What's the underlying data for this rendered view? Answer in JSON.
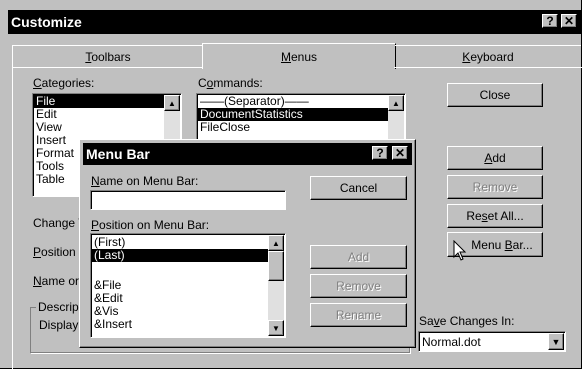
{
  "customize": {
    "title": "Customize",
    "help_btn": "?",
    "close_btn": "✕",
    "tabs": [
      {
        "label": "Toolbars",
        "key": "T",
        "rest": "oolbars"
      },
      {
        "label": "Menus",
        "key": "M",
        "rest": "enus"
      },
      {
        "label": "Keyboard",
        "key": "K",
        "rest": "eyboard"
      }
    ],
    "categories_label_key": "C",
    "categories_label_rest": "ategories:",
    "categories": [
      "File",
      "Edit",
      "View",
      "Insert",
      "Format",
      "Tools",
      "Table"
    ],
    "commands_label_pre": "C",
    "commands_label_key": "o",
    "commands_label_rest": "mmands:",
    "commands": [
      "——(Separator)——",
      "DocumentStatistics",
      "FileClose"
    ],
    "change_label": "Change V",
    "position_label_key": "P",
    "position_label_rest": "osition c",
    "name_label_key": "N",
    "name_label_rest": "ame or",
    "description_group": "Descrip",
    "description_text": "Display",
    "buttons": {
      "close": "Close",
      "add": "Add",
      "add_key": "A",
      "remove": "Remove",
      "reset_all_pre": "Re",
      "reset_all_key": "s",
      "reset_all_rest": "et All...",
      "menu_bar_pre": "Menu ",
      "menu_bar_key": "B",
      "menu_bar_rest": "ar..."
    },
    "save_label_pre": "Sa",
    "save_label_key": "v",
    "save_label_rest": "e Changes In:",
    "save_value": "Normal.dot"
  },
  "menubar_dialog": {
    "title": "Menu Bar",
    "help_btn": "?",
    "close_btn": "✕",
    "name_label_key": "N",
    "name_label_rest": "ame on Menu Bar:",
    "name_value": "",
    "position_label_key": "P",
    "position_label_rest": "osition on Menu Bar:",
    "positions": [
      "(First)",
      "(Last)",
      "",
      "&File",
      "&Edit",
      "&Vis",
      "&Insert"
    ],
    "buttons": {
      "cancel": "Cancel",
      "add": "Add",
      "remove": "Remove",
      "rename": "Rename"
    }
  },
  "colors": {
    "face": "#c0c0c0",
    "titlebar": "#000000",
    "selection": "#000000"
  }
}
